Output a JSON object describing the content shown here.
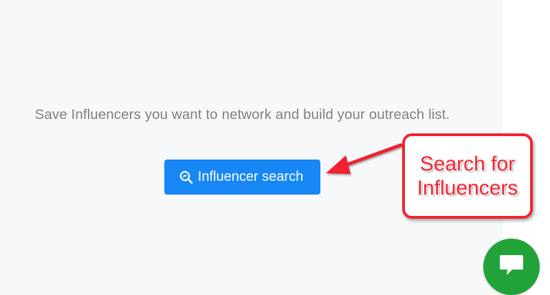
{
  "empty_state": {
    "message": "Save Influencers you want to network and build your outreach list.",
    "button_label": "Influencer search",
    "button_icon": "search-icon"
  },
  "annotation": {
    "callout_text": "Search for Influencers",
    "callout_color": "#f02430",
    "arrow_icon": "arrow-left"
  },
  "chat_widget": {
    "icon": "chat-bubble-icon",
    "color": "#22a33a"
  },
  "colors": {
    "accent": "#1787f5",
    "background": "#f7f8fa",
    "muted_text": "#808080"
  }
}
